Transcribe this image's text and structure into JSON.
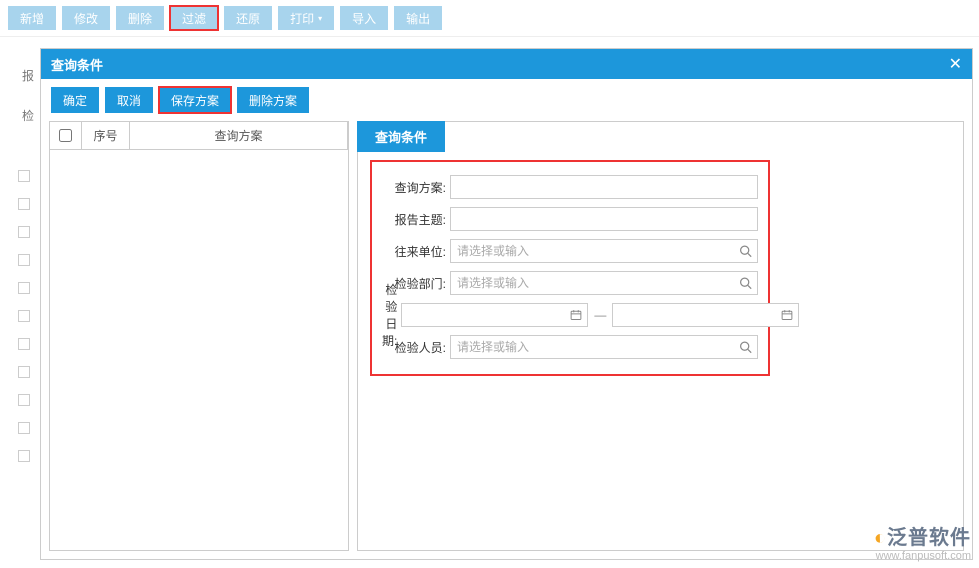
{
  "toolbar": {
    "add": "新增",
    "edit": "修改",
    "del": "删除",
    "filter": "过滤",
    "restore": "还原",
    "print": "打印",
    "import": "导入",
    "export": "输出"
  },
  "bg": {
    "label1": "报",
    "label2": "检"
  },
  "modal": {
    "title": "查询条件",
    "ok": "确定",
    "cancel": "取消",
    "save_scheme": "保存方案",
    "del_scheme": "删除方案"
  },
  "grid": {
    "col_seq": "序号",
    "col_scheme": "查询方案"
  },
  "right": {
    "title": "查询条件"
  },
  "form": {
    "scheme": {
      "label": "查询方案:"
    },
    "subject": {
      "label": "报告主题:"
    },
    "partner": {
      "label": "往来单位:",
      "placeholder": "请选择或输入"
    },
    "dept": {
      "label": "检验部门:",
      "placeholder": "请选择或输入"
    },
    "date": {
      "label": "检验日期:",
      "sep": "—"
    },
    "staff": {
      "label": "检验人员:",
      "placeholder": "请选择或输入"
    }
  },
  "watermark": {
    "brand": "泛普软件",
    "url": "www.fanpusoft.com"
  }
}
